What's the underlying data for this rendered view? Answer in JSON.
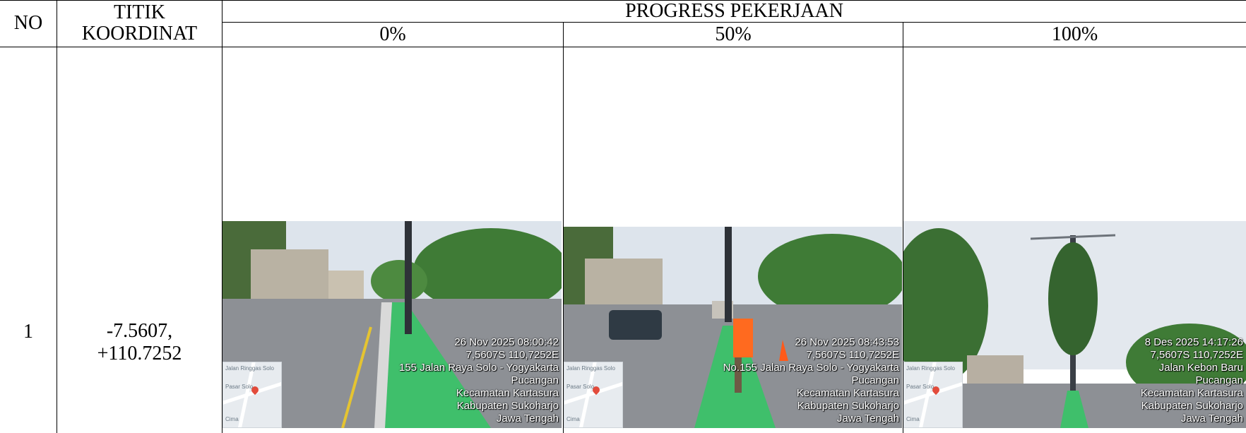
{
  "table": {
    "headers": {
      "no": "NO",
      "titik_koordinat_line1": "TITIK",
      "titik_koordinat_line2": "KOORDINAT",
      "progress": "PROGRESS PEKERJAAN",
      "p0": "0%",
      "p50": "50%",
      "p100": "100%"
    },
    "rows": [
      {
        "no": "1",
        "coord_line1": "-7.5607,",
        "coord_line2": "+110.7252",
        "photos": {
          "p0": {
            "lines": [
              "26 Nov 2025 08:00:42",
              "7,5607S 110,7252E",
              "155 Jalan Raya Solo - Yogyakarta",
              "Pucangan",
              "Kecamatan Kartasura",
              "Kabupaten Sukoharjo",
              "Jawa Tengah"
            ],
            "map_labels": [
              "Jalan Ringgas Solo",
              "Pasar Solo",
              "Cima"
            ]
          },
          "p50": {
            "lines": [
              "26 Nov 2025 08:43:53",
              "7,5607S 110,7252E",
              "No.155 Jalan Raya Solo - Yogyakarta",
              "Pucangan",
              "Kecamatan Kartasura",
              "Kabupaten Sukoharjo",
              "Jawa Tengah"
            ],
            "map_labels": [
              "Jalan Ringgas Solo",
              "Pasar Solo",
              "Cima"
            ]
          },
          "p100": {
            "lines": [
              "8 Des 2025 14:17:26",
              "7,5607S 110,7252E",
              "Jalan Kebon Baru",
              "Pucangan",
              "Kecamatan Kartasura",
              "Kabupaten Sukoharjo",
              "Jawa Tengah"
            ],
            "map_labels": [
              "Jalan Ringgas Solo",
              "Pasar Solo",
              "Cima"
            ]
          }
        }
      }
    ]
  },
  "colors": {
    "border": "#000000",
    "bike_lane": "#3fbf6b",
    "asphalt": "#8c8f94",
    "sky": "#dfe6ee",
    "trees": "#3d7a37"
  }
}
